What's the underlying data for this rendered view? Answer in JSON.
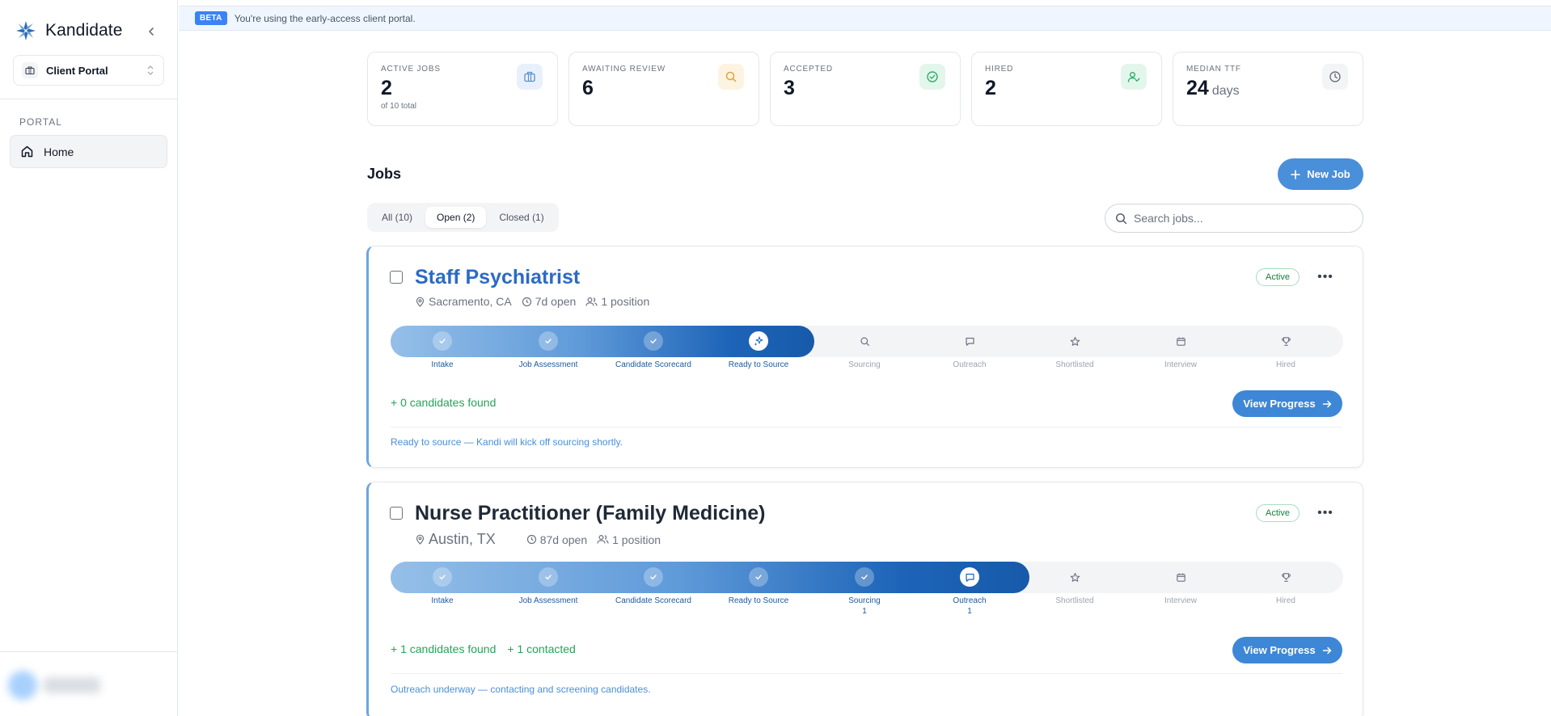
{
  "sidebar": {
    "brand": "Kandidate",
    "portal_select": "Client Portal",
    "section_label": "PORTAL",
    "nav": [
      {
        "label": "Home",
        "icon": "home-icon"
      }
    ]
  },
  "banner": {
    "badge": "BETA",
    "text": "You're using the early-access client portal."
  },
  "stats": [
    {
      "label": "ACTIVE JOBS",
      "value": "2",
      "sub": "of 10 total",
      "icon": "briefcase-icon",
      "color": "#5a8fd0"
    },
    {
      "label": "AWAITING REVIEW",
      "value": "6",
      "sub": "",
      "icon": "search-icon",
      "color": "#e2a33a"
    },
    {
      "label": "ACCEPTED",
      "value": "3",
      "sub": "",
      "icon": "check-circle-icon",
      "color": "#2fae6a"
    },
    {
      "label": "HIRED",
      "value": "2",
      "sub": "",
      "icon": "user-check-icon",
      "color": "#2fae6a"
    },
    {
      "label": "MEDIAN TTF",
      "value": "24",
      "unit": "days",
      "sub": "",
      "icon": "clock-icon",
      "color": "#6b7280"
    }
  ],
  "jobs_section": {
    "title": "Jobs",
    "new_job_label": "New Job",
    "tabs": [
      {
        "label": "All (10)",
        "active": false
      },
      {
        "label": "Open (2)",
        "active": true
      },
      {
        "label": "Closed (1)",
        "active": false
      }
    ],
    "search_placeholder": "Search jobs..."
  },
  "jobs": [
    {
      "title": "Staff Psychiatrist",
      "location": "Sacramento, CA",
      "open": "7d open",
      "positions": "1 position",
      "status": "Active",
      "stages": [
        {
          "label": "Intake",
          "state": "done",
          "count": ""
        },
        {
          "label": "Job Assessment",
          "state": "done",
          "count": ""
        },
        {
          "label": "Candidate Scorecard",
          "state": "done",
          "count": ""
        },
        {
          "label": "Ready to Source",
          "state": "current",
          "count": ""
        },
        {
          "label": "Sourcing",
          "state": "pending",
          "count": ""
        },
        {
          "label": "Outreach",
          "state": "pending",
          "count": ""
        },
        {
          "label": "Shortlisted",
          "state": "pending",
          "count": ""
        },
        {
          "label": "Interview",
          "state": "pending",
          "count": ""
        },
        {
          "label": "Hired",
          "state": "pending",
          "count": ""
        }
      ],
      "found": [
        "+ 0 candidates found"
      ],
      "view_label": "View Progress",
      "note": "Ready to source — Kandi will kick off sourcing shortly."
    },
    {
      "title": "Nurse Practitioner (Family Medicine)",
      "location": "Austin, TX",
      "open": "87d open",
      "positions": "1 position",
      "status": "Active",
      "stages": [
        {
          "label": "Intake",
          "state": "done",
          "count": ""
        },
        {
          "label": "Job Assessment",
          "state": "done",
          "count": ""
        },
        {
          "label": "Candidate Scorecard",
          "state": "done",
          "count": ""
        },
        {
          "label": "Ready to Source",
          "state": "done",
          "count": ""
        },
        {
          "label": "Sourcing",
          "state": "done",
          "count": "1"
        },
        {
          "label": "Outreach",
          "state": "current",
          "count": "1"
        },
        {
          "label": "Shortlisted",
          "state": "pending",
          "count": ""
        },
        {
          "label": "Interview",
          "state": "pending",
          "count": ""
        },
        {
          "label": "Hired",
          "state": "pending",
          "count": ""
        }
      ],
      "found": [
        "+ 1 candidates found",
        "+ 1 contacted"
      ],
      "view_label": "View Progress",
      "note": "Outreach underway — contacting and screening candidates."
    }
  ]
}
